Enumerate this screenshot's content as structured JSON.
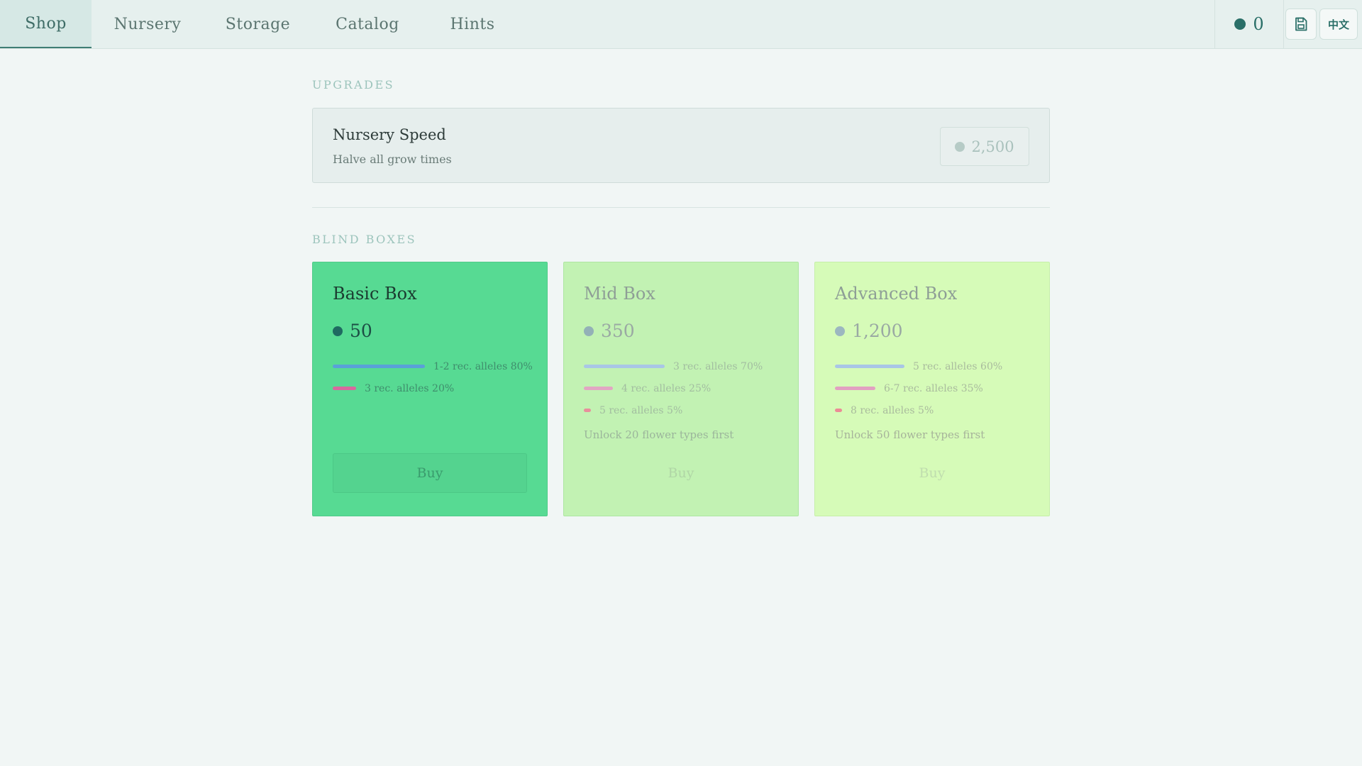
{
  "nav": {
    "tabs": [
      {
        "label": "Shop",
        "active": true
      },
      {
        "label": "Nursery",
        "active": false
      },
      {
        "label": "Storage",
        "active": false
      },
      {
        "label": "Catalog",
        "active": false
      },
      {
        "label": "Hints",
        "active": false
      }
    ],
    "coins": "0",
    "save_icon": "save-icon",
    "language_label": "中文"
  },
  "upgrades": {
    "section_label": "UPGRADES",
    "items": [
      {
        "title": "Nursery Speed",
        "description": "Halve all grow times",
        "price": "2,500"
      }
    ]
  },
  "blind_boxes": {
    "section_label": "BLIND BOXES",
    "boxes": [
      {
        "title": "Basic Box",
        "price": "50",
        "color": "#57da93",
        "odds": [
          {
            "label": "1-2 rec. alleles 80%",
            "percent": 80,
            "color": "#5aa0d8"
          },
          {
            "label": "3 rec. alleles 20%",
            "percent": 20,
            "color": "#d8689e"
          }
        ],
        "unlock_note": "",
        "buy_label": "Buy"
      },
      {
        "title": "Mid Box",
        "price": "350",
        "color": "#c2f2b3",
        "odds": [
          {
            "label": "3 rec. alleles 70%",
            "percent": 70,
            "color": "#a9c6e6"
          },
          {
            "label": "4 rec. alleles 25%",
            "percent": 25,
            "color": "#e2a6c3"
          },
          {
            "label": "5 rec. alleles 5%",
            "percent": 5,
            "color": "#e88f9c"
          }
        ],
        "unlock_note": "Unlock 20 flower types first",
        "buy_label": "Buy"
      },
      {
        "title": "Advanced Box",
        "price": "1,200",
        "color": "#d6fbb8",
        "odds": [
          {
            "label": "5 rec. alleles 60%",
            "percent": 60,
            "color": "#a9c6e6"
          },
          {
            "label": "6-7 rec. alleles 35%",
            "percent": 35,
            "color": "#e2a0c1"
          },
          {
            "label": "8 rec. alleles 5%",
            "percent": 5,
            "color": "#ec8c96"
          }
        ],
        "unlock_note": "Unlock 50 flower types first",
        "buy_label": "Buy"
      }
    ]
  }
}
